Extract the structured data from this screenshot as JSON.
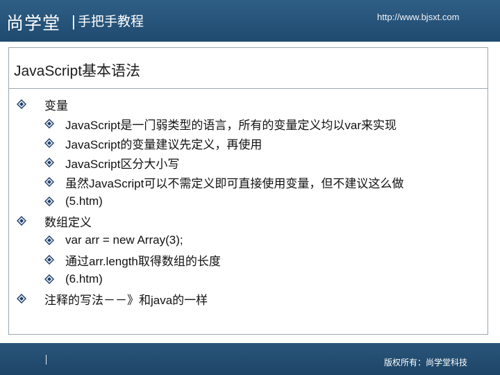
{
  "header": {
    "brand": "尚学堂",
    "separator": "|",
    "subtitle": "手把手教程",
    "url": "http://www.bjsxt.com"
  },
  "slide": {
    "title": "JavaScript基本语法",
    "items": [
      {
        "level": 1,
        "text": "变量"
      },
      {
        "level": 2,
        "text": "JavaScript是一门弱类型的语言，所有的变量定义均以var来实现"
      },
      {
        "level": 2,
        "text": "JavaScript的变量建议先定义，再使用"
      },
      {
        "level": 2,
        "text": "JavaScript区分大小写"
      },
      {
        "level": 2,
        "text": "虽然JavaScript可以不需定义即可直接使用变量，但不建议这么做"
      },
      {
        "level": 2,
        "text": "(5.htm)"
      },
      {
        "level": 1,
        "text": "数组定义"
      },
      {
        "level": 2,
        "text": "var arr = new Array(3);"
      },
      {
        "level": 2,
        "text": "通过arr.length取得数组的长度"
      },
      {
        "level": 2,
        "text": "(6.htm)"
      },
      {
        "level": 1,
        "text": "注释的写法－－》和java的一样"
      }
    ]
  },
  "footer": {
    "copyright": "版权所有：尚学堂科技"
  },
  "colors": {
    "header_bg": "#2f5e84",
    "footer_bg": "#1c4567",
    "bullet": "#1f3f6b"
  }
}
